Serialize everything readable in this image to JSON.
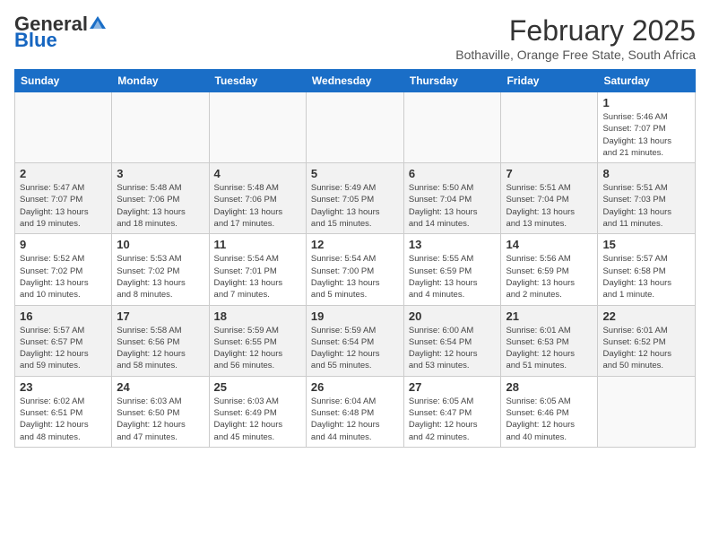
{
  "header": {
    "logo_general": "General",
    "logo_blue": "Blue",
    "month_title": "February 2025",
    "subtitle": "Bothaville, Orange Free State, South Africa"
  },
  "weekdays": [
    "Sunday",
    "Monday",
    "Tuesday",
    "Wednesday",
    "Thursday",
    "Friday",
    "Saturday"
  ],
  "weeks": [
    {
      "days": [
        {
          "num": "",
          "info": ""
        },
        {
          "num": "",
          "info": ""
        },
        {
          "num": "",
          "info": ""
        },
        {
          "num": "",
          "info": ""
        },
        {
          "num": "",
          "info": ""
        },
        {
          "num": "",
          "info": ""
        },
        {
          "num": "1",
          "info": "Sunrise: 5:46 AM\nSunset: 7:07 PM\nDaylight: 13 hours\nand 21 minutes."
        }
      ]
    },
    {
      "days": [
        {
          "num": "2",
          "info": "Sunrise: 5:47 AM\nSunset: 7:07 PM\nDaylight: 13 hours\nand 19 minutes."
        },
        {
          "num": "3",
          "info": "Sunrise: 5:48 AM\nSunset: 7:06 PM\nDaylight: 13 hours\nand 18 minutes."
        },
        {
          "num": "4",
          "info": "Sunrise: 5:48 AM\nSunset: 7:06 PM\nDaylight: 13 hours\nand 17 minutes."
        },
        {
          "num": "5",
          "info": "Sunrise: 5:49 AM\nSunset: 7:05 PM\nDaylight: 13 hours\nand 15 minutes."
        },
        {
          "num": "6",
          "info": "Sunrise: 5:50 AM\nSunset: 7:04 PM\nDaylight: 13 hours\nand 14 minutes."
        },
        {
          "num": "7",
          "info": "Sunrise: 5:51 AM\nSunset: 7:04 PM\nDaylight: 13 hours\nand 13 minutes."
        },
        {
          "num": "8",
          "info": "Sunrise: 5:51 AM\nSunset: 7:03 PM\nDaylight: 13 hours\nand 11 minutes."
        }
      ]
    },
    {
      "days": [
        {
          "num": "9",
          "info": "Sunrise: 5:52 AM\nSunset: 7:02 PM\nDaylight: 13 hours\nand 10 minutes."
        },
        {
          "num": "10",
          "info": "Sunrise: 5:53 AM\nSunset: 7:02 PM\nDaylight: 13 hours\nand 8 minutes."
        },
        {
          "num": "11",
          "info": "Sunrise: 5:54 AM\nSunset: 7:01 PM\nDaylight: 13 hours\nand 7 minutes."
        },
        {
          "num": "12",
          "info": "Sunrise: 5:54 AM\nSunset: 7:00 PM\nDaylight: 13 hours\nand 5 minutes."
        },
        {
          "num": "13",
          "info": "Sunrise: 5:55 AM\nSunset: 6:59 PM\nDaylight: 13 hours\nand 4 minutes."
        },
        {
          "num": "14",
          "info": "Sunrise: 5:56 AM\nSunset: 6:59 PM\nDaylight: 13 hours\nand 2 minutes."
        },
        {
          "num": "15",
          "info": "Sunrise: 5:57 AM\nSunset: 6:58 PM\nDaylight: 13 hours\nand 1 minute."
        }
      ]
    },
    {
      "days": [
        {
          "num": "16",
          "info": "Sunrise: 5:57 AM\nSunset: 6:57 PM\nDaylight: 12 hours\nand 59 minutes."
        },
        {
          "num": "17",
          "info": "Sunrise: 5:58 AM\nSunset: 6:56 PM\nDaylight: 12 hours\nand 58 minutes."
        },
        {
          "num": "18",
          "info": "Sunrise: 5:59 AM\nSunset: 6:55 PM\nDaylight: 12 hours\nand 56 minutes."
        },
        {
          "num": "19",
          "info": "Sunrise: 5:59 AM\nSunset: 6:54 PM\nDaylight: 12 hours\nand 55 minutes."
        },
        {
          "num": "20",
          "info": "Sunrise: 6:00 AM\nSunset: 6:54 PM\nDaylight: 12 hours\nand 53 minutes."
        },
        {
          "num": "21",
          "info": "Sunrise: 6:01 AM\nSunset: 6:53 PM\nDaylight: 12 hours\nand 51 minutes."
        },
        {
          "num": "22",
          "info": "Sunrise: 6:01 AM\nSunset: 6:52 PM\nDaylight: 12 hours\nand 50 minutes."
        }
      ]
    },
    {
      "days": [
        {
          "num": "23",
          "info": "Sunrise: 6:02 AM\nSunset: 6:51 PM\nDaylight: 12 hours\nand 48 minutes."
        },
        {
          "num": "24",
          "info": "Sunrise: 6:03 AM\nSunset: 6:50 PM\nDaylight: 12 hours\nand 47 minutes."
        },
        {
          "num": "25",
          "info": "Sunrise: 6:03 AM\nSunset: 6:49 PM\nDaylight: 12 hours\nand 45 minutes."
        },
        {
          "num": "26",
          "info": "Sunrise: 6:04 AM\nSunset: 6:48 PM\nDaylight: 12 hours\nand 44 minutes."
        },
        {
          "num": "27",
          "info": "Sunrise: 6:05 AM\nSunset: 6:47 PM\nDaylight: 12 hours\nand 42 minutes."
        },
        {
          "num": "28",
          "info": "Sunrise: 6:05 AM\nSunset: 6:46 PM\nDaylight: 12 hours\nand 40 minutes."
        },
        {
          "num": "",
          "info": ""
        }
      ]
    }
  ]
}
